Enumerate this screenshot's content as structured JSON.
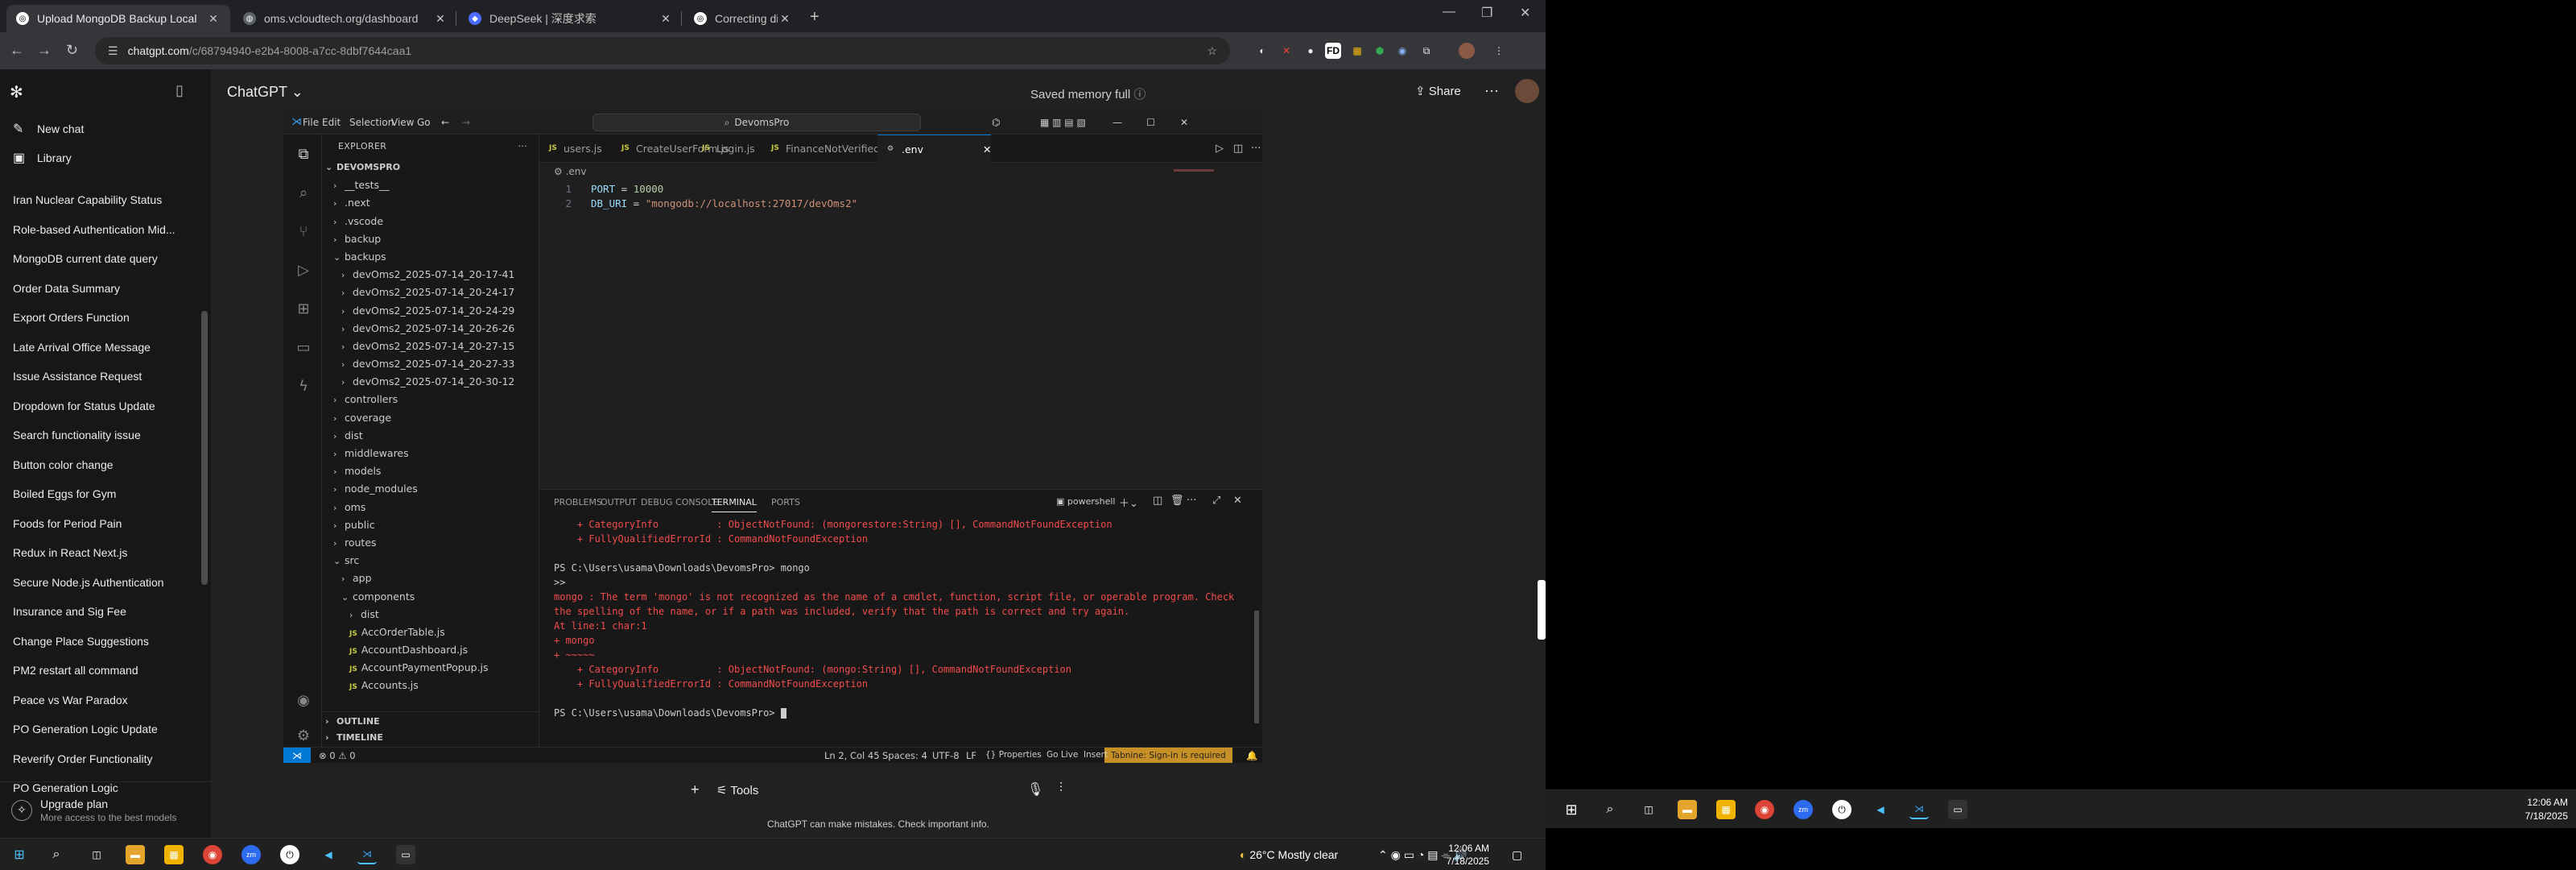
{
  "browser": {
    "tabs": [
      {
        "label": "Upload MongoDB Backup Local",
        "active": true,
        "favicon": "chatgpt-icon"
      },
      {
        "label": "oms.vcloudtech.org/dashboard",
        "active": false,
        "favicon": "globe-icon"
      },
      {
        "label": "DeepSeek | 深度求索",
        "active": false,
        "favicon": "deepseek-icon"
      },
      {
        "label": "Correcting distributor logic in",
        "active": false,
        "favicon": "chatgpt-icon"
      }
    ],
    "address_host": "chatgpt.com",
    "address_path": "/c/68794940-e2b4-8008-a7cc-8dbf7644caa1"
  },
  "sidebar": {
    "new_chat": "New chat",
    "library": "Library",
    "history": [
      "Iran Nuclear Capability Status",
      "Role-based Authentication Mid...",
      "MongoDB current date query",
      "Order Data Summary",
      "Export Orders Function",
      "Late Arrival Office Message",
      "Issue Assistance Request",
      "Dropdown for Status Update",
      "Search functionality issue",
      "Button color change",
      "Boiled Eggs for Gym",
      "Foods for Period Pain",
      "Redux in React Next.js",
      "Secure Node.js Authentication",
      "Insurance and Sig Fee",
      "Change Place Suggestions",
      "PM2 restart all command",
      "Peace vs War Paradox",
      "PO Generation Logic Update",
      "Reverify Order Functionality",
      "PO Generation Logic"
    ],
    "upgrade_title": "Upgrade plan",
    "upgrade_sub": "More access to the best models"
  },
  "header": {
    "model": "ChatGPT",
    "memory": "Saved memory full",
    "share": "Share"
  },
  "vscode": {
    "menu": [
      "File",
      "Edit",
      "Selection",
      "View",
      "Go",
      "···"
    ],
    "search": "DevomsPro",
    "explorer_title": "EXPLORER",
    "root": "DEVOMSPRO",
    "tree": [
      {
        "label": "__tests__",
        "indent": 1,
        "type": "folder",
        "open": false
      },
      {
        "label": ".next",
        "indent": 1,
        "type": "folder",
        "open": false
      },
      {
        "label": ".vscode",
        "indent": 1,
        "type": "folder",
        "open": false
      },
      {
        "label": "backup",
        "indent": 1,
        "type": "folder",
        "open": false
      },
      {
        "label": "backups",
        "indent": 1,
        "type": "folder",
        "open": true
      },
      {
        "label": "devOms2_2025-07-14_20-17-41",
        "indent": 2,
        "type": "folder",
        "open": false
      },
      {
        "label": "devOms2_2025-07-14_20-24-17",
        "indent": 2,
        "type": "folder",
        "open": false
      },
      {
        "label": "devOms2_2025-07-14_20-24-29",
        "indent": 2,
        "type": "folder",
        "open": false
      },
      {
        "label": "devOms2_2025-07-14_20-26-26",
        "indent": 2,
        "type": "folder",
        "open": false
      },
      {
        "label": "devOms2_2025-07-14_20-27-15",
        "indent": 2,
        "type": "folder",
        "open": false
      },
      {
        "label": "devOms2_2025-07-14_20-27-33",
        "indent": 2,
        "type": "folder",
        "open": false
      },
      {
        "label": "devOms2_2025-07-14_20-30-12",
        "indent": 2,
        "type": "folder",
        "open": false
      },
      {
        "label": "controllers",
        "indent": 1,
        "type": "folder",
        "open": false
      },
      {
        "label": "coverage",
        "indent": 1,
        "type": "folder",
        "open": false
      },
      {
        "label": "dist",
        "indent": 1,
        "type": "folder",
        "open": false
      },
      {
        "label": "middlewares",
        "indent": 1,
        "type": "folder",
        "open": false
      },
      {
        "label": "models",
        "indent": 1,
        "type": "folder",
        "open": false
      },
      {
        "label": "node_modules",
        "indent": 1,
        "type": "folder",
        "open": false
      },
      {
        "label": "oms",
        "indent": 1,
        "type": "folder",
        "open": false
      },
      {
        "label": "public",
        "indent": 1,
        "type": "folder",
        "open": false
      },
      {
        "label": "routes",
        "indent": 1,
        "type": "folder",
        "open": false
      },
      {
        "label": "src",
        "indent": 1,
        "type": "folder",
        "open": true
      },
      {
        "label": "app",
        "indent": 2,
        "type": "folder",
        "open": false
      },
      {
        "label": "components",
        "indent": 2,
        "type": "folder",
        "open": true
      },
      {
        "label": "dist",
        "indent": 3,
        "type": "folder",
        "open": false
      },
      {
        "label": "AccOrderTable.js",
        "indent": 3,
        "type": "js"
      },
      {
        "label": "AccountDashboard.js",
        "indent": 3,
        "type": "js"
      },
      {
        "label": "AccountPaymentPopup.js",
        "indent": 3,
        "type": "js"
      },
      {
        "label": "Accounts.js",
        "indent": 3,
        "type": "js"
      }
    ],
    "outline": "OUTLINE",
    "timeline": "TIMELINE",
    "tabs": [
      {
        "label": "users.js",
        "js": true
      },
      {
        "label": "CreateUserForm.js",
        "js": true
      },
      {
        "label": "Login.js",
        "js": true
      },
      {
        "label": "FinanceNotVerifiedOrderTable.js",
        "js": true
      },
      {
        "label": ".env",
        "js": false,
        "active": true
      }
    ],
    "breadcrumb": ".env",
    "code": [
      {
        "no": "1",
        "key": "PORT",
        "eq": " = ",
        "val": "10000",
        "valtype": "n"
      },
      {
        "no": "2",
        "key": "DB_URI",
        "eq": " = ",
        "val": "\"mongodb://localhost:27017/devOms2\"",
        "valtype": "s"
      }
    ],
    "panel_tabs": [
      "PROBLEMS",
      "OUTPUT",
      "DEBUG CONSOLE",
      "TERMINAL",
      "PORTS"
    ],
    "shell": "powershell",
    "terminal": [
      {
        "text": "    + CategoryInfo          : ObjectNotFound: (mongorestore:String) [], CommandNotFoundException",
        "cls": "err"
      },
      {
        "text": "    + FullyQualifiedErrorId : CommandNotFoundException",
        "cls": "err"
      },
      {
        "text": "",
        "cls": "pl"
      },
      {
        "text": "PS C:\\Users\\usama\\Downloads\\DevomsPro> mongo",
        "cls": "pl"
      },
      {
        "text": ">>",
        "cls": "pl"
      },
      {
        "text": "mongo : The term 'mongo' is not recognized as the name of a cmdlet, function, script file, or operable program. Check",
        "cls": "err"
      },
      {
        "text": "the spelling of the name, or if a path was included, verify that the path is correct and try again.",
        "cls": "err"
      },
      {
        "text": "At line:1 char:1",
        "cls": "err"
      },
      {
        "text": "+ mongo",
        "cls": "err"
      },
      {
        "text": "+ ~~~~~",
        "cls": "err"
      },
      {
        "text": "    + CategoryInfo          : ObjectNotFound: (mongo:String) [], CommandNotFoundException",
        "cls": "err"
      },
      {
        "text": "    + FullyQualifiedErrorId : CommandNotFoundException",
        "cls": "err"
      },
      {
        "text": "",
        "cls": "pl"
      },
      {
        "text": "PS C:\\Users\\usama\\Downloads\\DevomsPro> ",
        "cls": "pl"
      }
    ],
    "status": {
      "problems": "⊗ 0 ⚠ 0",
      "position": "Ln 2, Col 45",
      "spaces": "Spaces: 4",
      "encoding": "UTF-8",
      "eol": "LF",
      "language": "{} Properties",
      "golive": "Go Live",
      "mode": "Insert",
      "tabnine": "Tabnine: Sign-in is required"
    }
  },
  "composer": {
    "tools": "Tools",
    "disclaimer": "ChatGPT can make mistakes. Check important info."
  },
  "taskbar": {
    "weather": "26°C  Mostly clear",
    "time": "12:06 AM",
    "date": "7/18/2025"
  },
  "taskbar2": {
    "time": "12:06 AM",
    "date": "7/18/2025"
  },
  "colors": {
    "vscode_accent": "#0078d4",
    "terminal_error": "#f14c4c",
    "tabnine_badge": "#c69026"
  }
}
